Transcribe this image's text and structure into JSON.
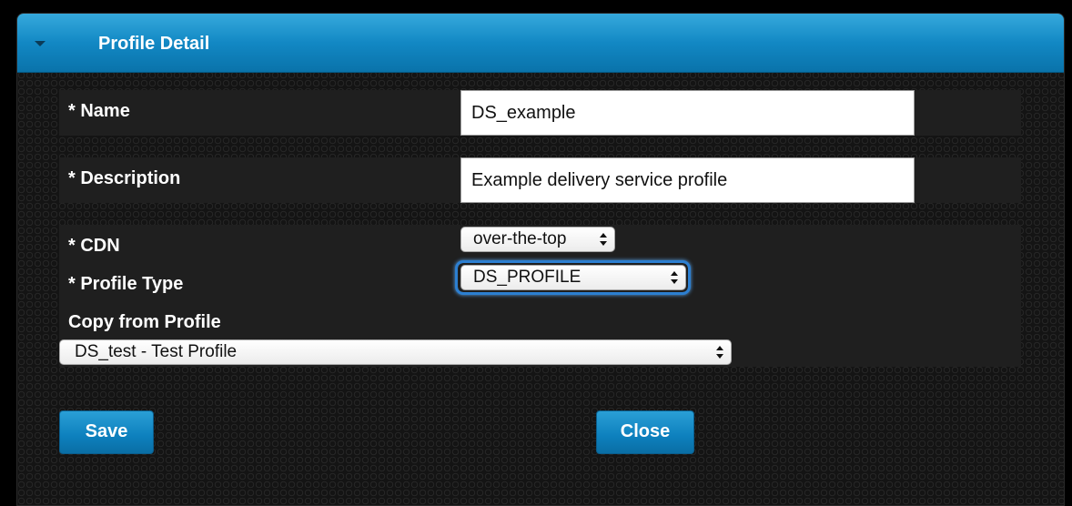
{
  "dialog": {
    "title": "Profile Detail"
  },
  "form": {
    "name_label": "* Name",
    "name_value": "DS_example",
    "description_label": "* Description",
    "description_value": "Example delivery service profile",
    "cdn_label": "* CDN",
    "cdn_selected": "over-the-top",
    "profile_type_label": "* Profile Type",
    "profile_type_selected": "DS_PROFILE",
    "copy_label": "Copy from Profile",
    "copy_selected": "DS_test - Test Profile"
  },
  "buttons": {
    "save_label": "Save",
    "close_label": "Close"
  },
  "colors": {
    "accent": "#1288c4",
    "focus": "#2c7fd1"
  },
  "icons": {
    "collapse": "caret-down-icon",
    "select": "up-down-arrows-icon"
  }
}
